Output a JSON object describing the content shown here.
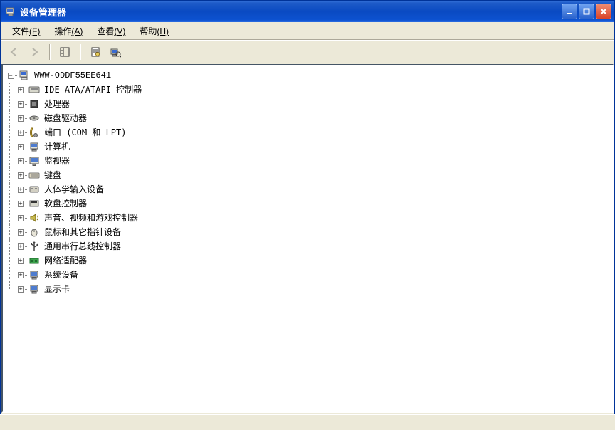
{
  "window": {
    "title": "设备管理器"
  },
  "menu": {
    "file_label": "文件",
    "file_hotkey": "(F)",
    "action_label": "操作",
    "action_hotkey": "(A)",
    "view_label": "查看",
    "view_hotkey": "(V)",
    "help_label": "帮助",
    "help_hotkey": "(H)"
  },
  "expander": {
    "minus": "−",
    "plus": "+"
  },
  "tree": {
    "root_label": "WWW-ODDF55EE641",
    "items": [
      {
        "label": "IDE ATA/ATAPI 控制器",
        "icon": "ide-controller-icon"
      },
      {
        "label": "处理器",
        "icon": "cpu-icon"
      },
      {
        "label": "磁盘驱动器",
        "icon": "disk-drive-icon"
      },
      {
        "label": "端口 (COM 和 LPT)",
        "icon": "port-icon"
      },
      {
        "label": "计算机",
        "icon": "computer-node-icon"
      },
      {
        "label": "监视器",
        "icon": "monitor-icon"
      },
      {
        "label": "键盘",
        "icon": "keyboard-icon"
      },
      {
        "label": "人体学输入设备",
        "icon": "hid-icon"
      },
      {
        "label": "软盘控制器",
        "icon": "floppy-controller-icon"
      },
      {
        "label": "声音、视频和游戏控制器",
        "icon": "sound-icon"
      },
      {
        "label": "鼠标和其它指针设备",
        "icon": "mouse-icon"
      },
      {
        "label": "通用串行总线控制器",
        "icon": "usb-icon"
      },
      {
        "label": "网络适配器",
        "icon": "network-adapter-icon"
      },
      {
        "label": "系统设备",
        "icon": "system-device-icon"
      },
      {
        "label": "显示卡",
        "icon": "display-adapter-icon"
      }
    ]
  }
}
